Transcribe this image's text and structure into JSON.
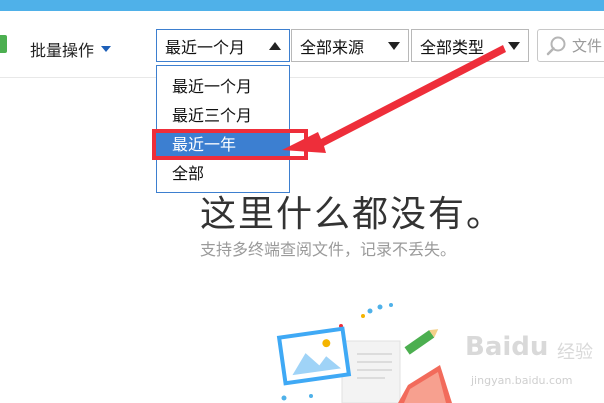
{
  "header": {
    "batch_label": "批量操作",
    "time_filter": "最近一个月",
    "source_filter": "全部来源",
    "type_filter": "全部类型",
    "search_placeholder": "文件"
  },
  "time_menu": {
    "items": [
      {
        "label": "最近一个月"
      },
      {
        "label": "最近三个月"
      },
      {
        "label": "最近一年",
        "selected": true
      },
      {
        "label": "全部"
      }
    ]
  },
  "empty_state": {
    "title": "这里什么都没有。",
    "subtitle": "支持多终端查阅文件，记录不丢失。"
  },
  "watermark": {
    "logo": "Baidu",
    "text": "经验",
    "url": "jingyan.baidu.com"
  },
  "colors": {
    "top_bar": "#4fb1e9",
    "menu_selected": "#3c7fd1",
    "annotation_red": "#ee2e3a"
  }
}
